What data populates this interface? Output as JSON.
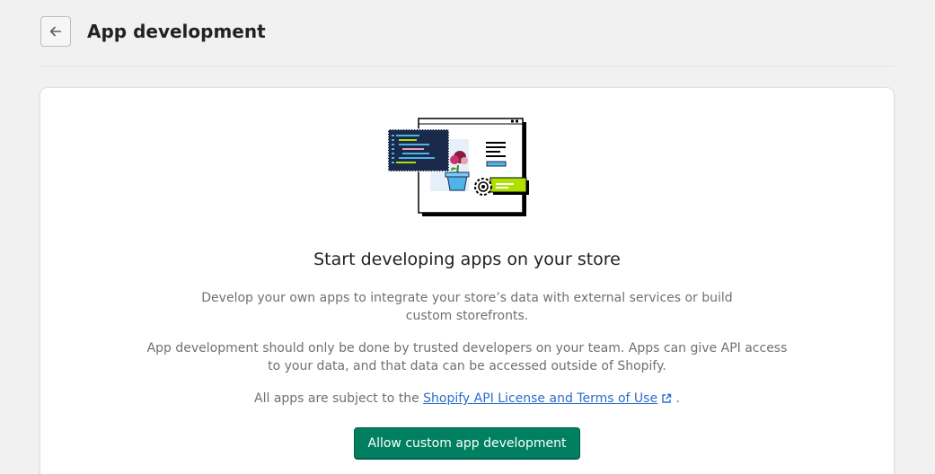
{
  "header": {
    "title": "App development",
    "back_icon": "arrow-left-icon"
  },
  "card": {
    "illustration_icon": "app-development-illustration",
    "heading": "Start developing apps on your store",
    "paragraph1": "Develop your own apps to integrate your store’s data with external services or build custom storefronts.",
    "paragraph2": "App development should only be done by trusted developers on your team. Apps can give API access to your data, and that data can be accessed outside of Shopify.",
    "paragraph3_prefix": "All apps are subject to the ",
    "license_link": "Shopify API License and Terms of Use",
    "paragraph3_suffix": " .",
    "external_link_icon": "external-link-icon",
    "primary_button": "Allow custom app development"
  },
  "colors": {
    "background": "#f1f1f1",
    "card": "#ffffff",
    "primary": "#008060",
    "link": "#2c6ecb",
    "illustration_green": "#aee100",
    "illustration_blue": "#4fb3e8",
    "illustration_navy": "#1b2a4a"
  }
}
